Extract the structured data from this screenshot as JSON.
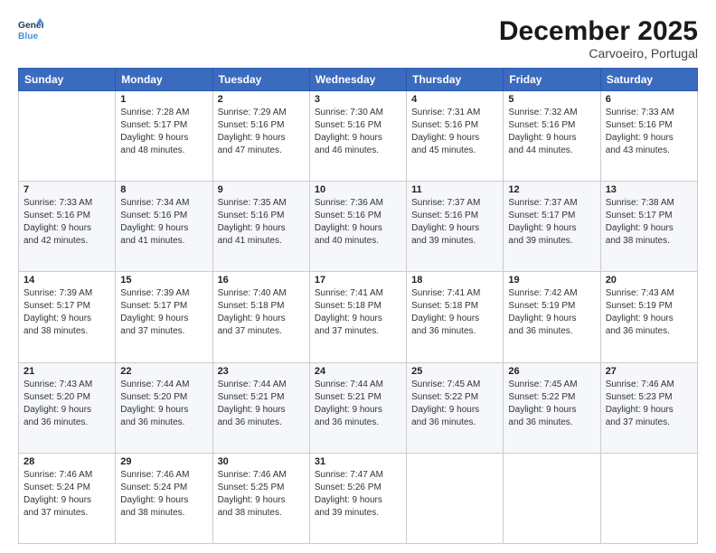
{
  "logo": {
    "line1": "General",
    "line2": "Blue"
  },
  "title": "December 2025",
  "subtitle": "Carvoeiro, Portugal",
  "header_days": [
    "Sunday",
    "Monday",
    "Tuesday",
    "Wednesday",
    "Thursday",
    "Friday",
    "Saturday"
  ],
  "weeks": [
    [
      {
        "date": "",
        "sunrise": "",
        "sunset": "",
        "daylight": ""
      },
      {
        "date": "1",
        "sunrise": "Sunrise: 7:28 AM",
        "sunset": "Sunset: 5:17 PM",
        "daylight": "Daylight: 9 hours and 48 minutes."
      },
      {
        "date": "2",
        "sunrise": "Sunrise: 7:29 AM",
        "sunset": "Sunset: 5:16 PM",
        "daylight": "Daylight: 9 hours and 47 minutes."
      },
      {
        "date": "3",
        "sunrise": "Sunrise: 7:30 AM",
        "sunset": "Sunset: 5:16 PM",
        "daylight": "Daylight: 9 hours and 46 minutes."
      },
      {
        "date": "4",
        "sunrise": "Sunrise: 7:31 AM",
        "sunset": "Sunset: 5:16 PM",
        "daylight": "Daylight: 9 hours and 45 minutes."
      },
      {
        "date": "5",
        "sunrise": "Sunrise: 7:32 AM",
        "sunset": "Sunset: 5:16 PM",
        "daylight": "Daylight: 9 hours and 44 minutes."
      },
      {
        "date": "6",
        "sunrise": "Sunrise: 7:33 AM",
        "sunset": "Sunset: 5:16 PM",
        "daylight": "Daylight: 9 hours and 43 minutes."
      }
    ],
    [
      {
        "date": "7",
        "sunrise": "Sunrise: 7:33 AM",
        "sunset": "Sunset: 5:16 PM",
        "daylight": "Daylight: 9 hours and 42 minutes."
      },
      {
        "date": "8",
        "sunrise": "Sunrise: 7:34 AM",
        "sunset": "Sunset: 5:16 PM",
        "daylight": "Daylight: 9 hours and 41 minutes."
      },
      {
        "date": "9",
        "sunrise": "Sunrise: 7:35 AM",
        "sunset": "Sunset: 5:16 PM",
        "daylight": "Daylight: 9 hours and 41 minutes."
      },
      {
        "date": "10",
        "sunrise": "Sunrise: 7:36 AM",
        "sunset": "Sunset: 5:16 PM",
        "daylight": "Daylight: 9 hours and 40 minutes."
      },
      {
        "date": "11",
        "sunrise": "Sunrise: 7:37 AM",
        "sunset": "Sunset: 5:16 PM",
        "daylight": "Daylight: 9 hours and 39 minutes."
      },
      {
        "date": "12",
        "sunrise": "Sunrise: 7:37 AM",
        "sunset": "Sunset: 5:17 PM",
        "daylight": "Daylight: 9 hours and 39 minutes."
      },
      {
        "date": "13",
        "sunrise": "Sunrise: 7:38 AM",
        "sunset": "Sunset: 5:17 PM",
        "daylight": "Daylight: 9 hours and 38 minutes."
      }
    ],
    [
      {
        "date": "14",
        "sunrise": "Sunrise: 7:39 AM",
        "sunset": "Sunset: 5:17 PM",
        "daylight": "Daylight: 9 hours and 38 minutes."
      },
      {
        "date": "15",
        "sunrise": "Sunrise: 7:39 AM",
        "sunset": "Sunset: 5:17 PM",
        "daylight": "Daylight: 9 hours and 37 minutes."
      },
      {
        "date": "16",
        "sunrise": "Sunrise: 7:40 AM",
        "sunset": "Sunset: 5:18 PM",
        "daylight": "Daylight: 9 hours and 37 minutes."
      },
      {
        "date": "17",
        "sunrise": "Sunrise: 7:41 AM",
        "sunset": "Sunset: 5:18 PM",
        "daylight": "Daylight: 9 hours and 37 minutes."
      },
      {
        "date": "18",
        "sunrise": "Sunrise: 7:41 AM",
        "sunset": "Sunset: 5:18 PM",
        "daylight": "Daylight: 9 hours and 36 minutes."
      },
      {
        "date": "19",
        "sunrise": "Sunrise: 7:42 AM",
        "sunset": "Sunset: 5:19 PM",
        "daylight": "Daylight: 9 hours and 36 minutes."
      },
      {
        "date": "20",
        "sunrise": "Sunrise: 7:43 AM",
        "sunset": "Sunset: 5:19 PM",
        "daylight": "Daylight: 9 hours and 36 minutes."
      }
    ],
    [
      {
        "date": "21",
        "sunrise": "Sunrise: 7:43 AM",
        "sunset": "Sunset: 5:20 PM",
        "daylight": "Daylight: 9 hours and 36 minutes."
      },
      {
        "date": "22",
        "sunrise": "Sunrise: 7:44 AM",
        "sunset": "Sunset: 5:20 PM",
        "daylight": "Daylight: 9 hours and 36 minutes."
      },
      {
        "date": "23",
        "sunrise": "Sunrise: 7:44 AM",
        "sunset": "Sunset: 5:21 PM",
        "daylight": "Daylight: 9 hours and 36 minutes."
      },
      {
        "date": "24",
        "sunrise": "Sunrise: 7:44 AM",
        "sunset": "Sunset: 5:21 PM",
        "daylight": "Daylight: 9 hours and 36 minutes."
      },
      {
        "date": "25",
        "sunrise": "Sunrise: 7:45 AM",
        "sunset": "Sunset: 5:22 PM",
        "daylight": "Daylight: 9 hours and 36 minutes."
      },
      {
        "date": "26",
        "sunrise": "Sunrise: 7:45 AM",
        "sunset": "Sunset: 5:22 PM",
        "daylight": "Daylight: 9 hours and 36 minutes."
      },
      {
        "date": "27",
        "sunrise": "Sunrise: 7:46 AM",
        "sunset": "Sunset: 5:23 PM",
        "daylight": "Daylight: 9 hours and 37 minutes."
      }
    ],
    [
      {
        "date": "28",
        "sunrise": "Sunrise: 7:46 AM",
        "sunset": "Sunset: 5:24 PM",
        "daylight": "Daylight: 9 hours and 37 minutes."
      },
      {
        "date": "29",
        "sunrise": "Sunrise: 7:46 AM",
        "sunset": "Sunset: 5:24 PM",
        "daylight": "Daylight: 9 hours and 38 minutes."
      },
      {
        "date": "30",
        "sunrise": "Sunrise: 7:46 AM",
        "sunset": "Sunset: 5:25 PM",
        "daylight": "Daylight: 9 hours and 38 minutes."
      },
      {
        "date": "31",
        "sunrise": "Sunrise: 7:47 AM",
        "sunset": "Sunset: 5:26 PM",
        "daylight": "Daylight: 9 hours and 39 minutes."
      },
      {
        "date": "",
        "sunrise": "",
        "sunset": "",
        "daylight": ""
      },
      {
        "date": "",
        "sunrise": "",
        "sunset": "",
        "daylight": ""
      },
      {
        "date": "",
        "sunrise": "",
        "sunset": "",
        "daylight": ""
      }
    ]
  ]
}
